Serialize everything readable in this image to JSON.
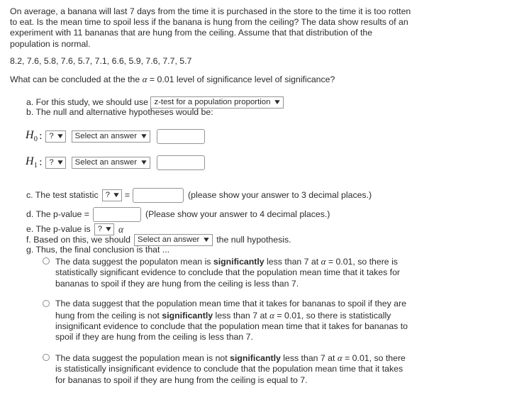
{
  "problem": {
    "intro": "On average, a banana will last 7 days from the time it is purchased in the store to the time it is too rotten to eat.  Is the mean time to spoil less if the banana is hung from the ceiling? The data show results of an experiment with 11 bananas that are hung from the ceiling. Assume that that distribution of the population is normal.",
    "data_values": "8.2, 7.6, 5.8, 7.6, 5.7, 7.1, 6.6, 5.9, 7.6, 7.7, 5.7",
    "question_prefix": "What can be concluded at the the ",
    "alpha_symbol": "α",
    "question_suffix": " = 0.01 level of significance level of significance?"
  },
  "items": {
    "a": {
      "label": "a. For this study, we should use",
      "select_value": "z-test for a population proportion"
    },
    "b": {
      "label": "b. The null and alternative hypotheses would be:"
    },
    "c": {
      "label": "c. The test statistic",
      "param_select": "?",
      "equals": "=",
      "input_value": "",
      "note": "(please show your answer to 3 decimal places.)"
    },
    "d": {
      "label": "d. The p-value =",
      "input_value": "",
      "note": "(Please show your answer to 4 decimal places.)"
    },
    "e": {
      "label": "e. The p-value is",
      "compare_select": "?",
      "alpha_symbol": "α"
    },
    "f": {
      "label_before": "f. Based on this, we should",
      "select_value": "Select an answer",
      "label_after": "the null hypothesis."
    },
    "g": {
      "label": "g. Thus, the final conclusion is that ..."
    }
  },
  "hypotheses": [
    {
      "symbol": "H",
      "subscript": "0",
      "colon": ":",
      "param_select": "?",
      "answer_select": "Select an answer",
      "input_value": ""
    },
    {
      "symbol": "H",
      "subscript": "1",
      "colon": ":",
      "param_select": "?",
      "answer_select": "Select an answer",
      "input_value": ""
    }
  ],
  "caret_glyph": "⌄",
  "options": [
    {
      "part1": "The data suggest the populaton mean is ",
      "bold": "significantly",
      "part2": " less than 7 at ",
      "alpha": "α",
      "part3": " = 0.01, so there is statistically significant evidence to conclude that the population mean time that it takes for bananas to spoil if they are hung from the ceiling is less than 7.",
      "selected": false
    },
    {
      "part1": "The data suggest that the population mean time that it takes for bananas to spoil if they are hung from the ceiling is not ",
      "bold": "significantly",
      "part2": " less than 7 at ",
      "alpha": "α",
      "part3": " = 0.01, so there is statistically insignificant evidence to conclude that the population mean time that it takes for bananas to spoil if they are hung from the ceiling is less than 7.",
      "selected": false
    },
    {
      "part1": "The data suggest the population mean is not ",
      "bold": "significantly",
      "part2": " less than 7 at ",
      "alpha": "α",
      "part3": " = 0.01, so there is statistically insignificant evidence to conclude that the population mean time that it takes for bananas to spoil if they are hung from the ceiling is equal to 7.",
      "selected": false
    }
  ]
}
